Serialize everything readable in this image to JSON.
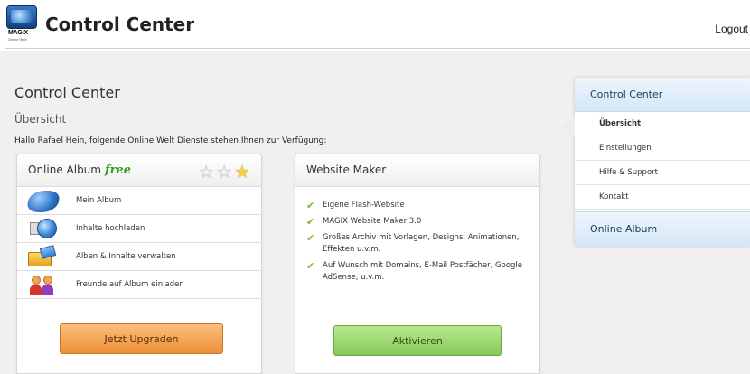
{
  "header": {
    "logo_brand": "MAGIX",
    "logo_sub": "Online Welt",
    "title": "Control Center",
    "logout_label": "Logout"
  },
  "main": {
    "title": "Control Center",
    "subtitle": "Übersicht",
    "greeting": "Hallo Rafael Hein, folgende Online Welt Dienste stehen Ihnen zur Verfügung:"
  },
  "online_album": {
    "title": "Online Album",
    "free_label": "free",
    "stars": [
      "☆",
      "☆",
      "★"
    ],
    "items": [
      {
        "label": "Mein Album",
        "icon": "album-icon"
      },
      {
        "label": "Inhalte hochladen",
        "icon": "upload-icon"
      },
      {
        "label": "Alben & Inhalte verwalten",
        "icon": "manage-icon"
      },
      {
        "label": "Freunde auf Album einladen",
        "icon": "friends-icon"
      }
    ],
    "button_label": "Jetzt Upgraden"
  },
  "website_maker": {
    "title": "Website Maker",
    "features": [
      "Eigene Flash-Website",
      "MAGIX Website Maker 3.0",
      "Großes Archiv mit Vorlagen, Designs, Animationen, Effekten u.v.m.",
      "Auf Wunsch mit Domains, E-Mail Postfächer, Google AdSense, u.v.m."
    ],
    "check_glyph": "✔",
    "button_label": "Aktivieren"
  },
  "sidebar": {
    "header": "Control Center",
    "items": [
      {
        "label": "Übersicht",
        "active": true
      },
      {
        "label": "Einstellungen",
        "active": false
      },
      {
        "label": "Hilfe & Support",
        "active": false
      },
      {
        "label": "Kontakt",
        "active": false
      }
    ],
    "footer": "Online Album"
  }
}
